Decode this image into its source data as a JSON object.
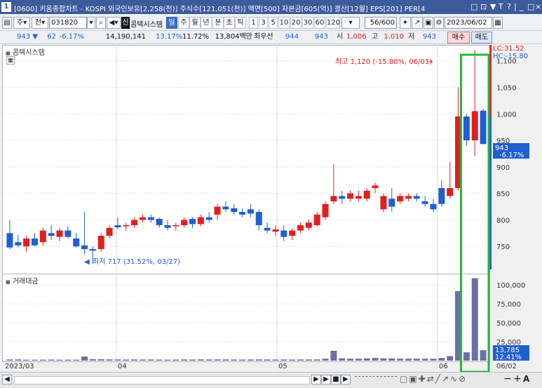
{
  "window": {
    "number": "1",
    "title": "[0600] 키움종합차트 - KOSPI 외국인보유[2,258(천)] 주식수[121,051(천)] 액면[500] 자본금[605(억)] 결산[12월] EPS[201] PER[4",
    "controls": [
      "□",
      "⊡",
      "▼",
      "T",
      "?",
      "|",
      "_",
      "□",
      "×"
    ]
  },
  "toolbar": {
    "mode": "주",
    "prev_label": "전",
    "code": "031820",
    "badge": "신",
    "stock_name": "콤텍시스템",
    "period_tabs": [
      "일",
      "주",
      "월",
      "년",
      "분",
      "초",
      "틱"
    ],
    "active_tab": "일",
    "interval_buttons": [
      "1",
      "3",
      "5",
      "10",
      "20",
      "30",
      "60",
      "120"
    ],
    "count_value": "56",
    "count_total": "/600",
    "date": "2023/06/02"
  },
  "quote": {
    "price": "943",
    "arrow": "▼",
    "change": "62",
    "change_rate": "-6.17%",
    "volume": "14,190,141",
    "rate2": "13.17%",
    "rate3": "11.72%",
    "amount": "13,804백만",
    "best_label": "최우선",
    "best_sell": "944",
    "best_buy": "943",
    "open_label": "시",
    "open": "1,006",
    "high_label": "고",
    "high": "1,010",
    "low_label": "저",
    "low": "943",
    "buy_label": "매수",
    "sell_label": "매도"
  },
  "price_panel": {
    "label": "콤텍시스템",
    "lc_label": "LC:31.52",
    "hc_label": "HC:-15.80",
    "current_price": "943",
    "current_rate": "-6.17%",
    "high_annotation": "최고 1,120 (-15.80%, 06/01)",
    "low_annotation": "최저 717 (31.52%, 03/27)",
    "ticks": [
      "1,100",
      "1,050",
      "1,000",
      "950",
      "900",
      "850",
      "800",
      "750"
    ]
  },
  "volume_panel": {
    "label": "거래대금",
    "ticks": [
      "100,000",
      "75,000",
      "50,000",
      "25,000"
    ],
    "current_value": "13,785",
    "current_rate": "12.41%"
  },
  "xaxis": {
    "labels": [
      "2023/03",
      "04",
      "05",
      "06"
    ],
    "right_label": "06/02"
  },
  "colors": {
    "up": "#e02020",
    "down": "#1f5fd0",
    "volume": "#6b6fa8",
    "highlight": "#28b43c"
  },
  "chart_data": {
    "type": "candlestick",
    "ylim": [
      700,
      1130
    ],
    "volume_ylim": [
      0,
      115000
    ],
    "candles": [
      {
        "o": 775,
        "h": 800,
        "l": 745,
        "c": 748
      },
      {
        "o": 758,
        "h": 772,
        "l": 748,
        "c": 752
      },
      {
        "o": 750,
        "h": 770,
        "l": 740,
        "c": 765
      },
      {
        "o": 765,
        "h": 775,
        "l": 750,
        "c": 752
      },
      {
        "o": 758,
        "h": 785,
        "l": 752,
        "c": 780
      },
      {
        "o": 775,
        "h": 790,
        "l": 762,
        "c": 770
      },
      {
        "o": 768,
        "h": 785,
        "l": 760,
        "c": 780
      },
      {
        "o": 780,
        "h": 788,
        "l": 765,
        "c": 768
      },
      {
        "o": 765,
        "h": 775,
        "l": 748,
        "c": 750
      },
      {
        "o": 752,
        "h": 815,
        "l": 735,
        "c": 745
      },
      {
        "o": 745,
        "h": 750,
        "l": 717,
        "c": 742
      },
      {
        "o": 745,
        "h": 775,
        "l": 740,
        "c": 770
      },
      {
        "o": 770,
        "h": 790,
        "l": 765,
        "c": 785
      },
      {
        "o": 790,
        "h": 805,
        "l": 782,
        "c": 786
      },
      {
        "o": 788,
        "h": 795,
        "l": 780,
        "c": 790
      },
      {
        "o": 790,
        "h": 805,
        "l": 785,
        "c": 800
      },
      {
        "o": 800,
        "h": 810,
        "l": 795,
        "c": 805
      },
      {
        "o": 805,
        "h": 810,
        "l": 795,
        "c": 800
      },
      {
        "o": 802,
        "h": 805,
        "l": 785,
        "c": 790
      },
      {
        "o": 790,
        "h": 800,
        "l": 780,
        "c": 785
      },
      {
        "o": 788,
        "h": 795,
        "l": 780,
        "c": 790
      },
      {
        "o": 790,
        "h": 805,
        "l": 785,
        "c": 800
      },
      {
        "o": 802,
        "h": 805,
        "l": 785,
        "c": 792
      },
      {
        "o": 792,
        "h": 810,
        "l": 788,
        "c": 805
      },
      {
        "o": 805,
        "h": 815,
        "l": 795,
        "c": 800
      },
      {
        "o": 810,
        "h": 830,
        "l": 800,
        "c": 825
      },
      {
        "o": 825,
        "h": 835,
        "l": 815,
        "c": 820
      },
      {
        "o": 822,
        "h": 830,
        "l": 810,
        "c": 815
      },
      {
        "o": 815,
        "h": 822,
        "l": 805,
        "c": 810
      },
      {
        "o": 820,
        "h": 830,
        "l": 805,
        "c": 812
      },
      {
        "o": 815,
        "h": 820,
        "l": 780,
        "c": 790
      },
      {
        "o": 785,
        "h": 795,
        "l": 775,
        "c": 780
      },
      {
        "o": 778,
        "h": 790,
        "l": 770,
        "c": 782
      },
      {
        "o": 780,
        "h": 790,
        "l": 760,
        "c": 768
      },
      {
        "o": 770,
        "h": 785,
        "l": 762,
        "c": 780
      },
      {
        "o": 780,
        "h": 795,
        "l": 775,
        "c": 790
      },
      {
        "o": 785,
        "h": 800,
        "l": 780,
        "c": 795
      },
      {
        "o": 790,
        "h": 815,
        "l": 788,
        "c": 810
      },
      {
        "o": 805,
        "h": 835,
        "l": 800,
        "c": 830
      },
      {
        "o": 835,
        "h": 905,
        "l": 830,
        "c": 845
      },
      {
        "o": 845,
        "h": 855,
        "l": 830,
        "c": 840
      },
      {
        "o": 840,
        "h": 855,
        "l": 835,
        "c": 850
      },
      {
        "o": 840,
        "h": 855,
        "l": 835,
        "c": 845
      },
      {
        "o": 840,
        "h": 860,
        "l": 835,
        "c": 855
      },
      {
        "o": 860,
        "h": 870,
        "l": 850,
        "c": 865
      },
      {
        "o": 820,
        "h": 850,
        "l": 815,
        "c": 845
      },
      {
        "o": 840,
        "h": 860,
        "l": 815,
        "c": 825
      },
      {
        "o": 835,
        "h": 850,
        "l": 830,
        "c": 845
      },
      {
        "o": 840,
        "h": 850,
        "l": 835,
        "c": 845
      },
      {
        "o": 845,
        "h": 850,
        "l": 835,
        "c": 840
      },
      {
        "o": 835,
        "h": 845,
        "l": 825,
        "c": 830
      },
      {
        "o": 830,
        "h": 840,
        "l": 815,
        "c": 820
      },
      {
        "o": 860,
        "h": 875,
        "l": 825,
        "c": 830
      },
      {
        "o": 845,
        "h": 910,
        "l": 840,
        "c": 860
      },
      {
        "o": 860,
        "h": 1050,
        "l": 855,
        "c": 995
      },
      {
        "o": 995,
        "h": 1000,
        "l": 940,
        "c": 950
      },
      {
        "o": 950,
        "h": 1120,
        "l": 920,
        "c": 1005
      },
      {
        "o": 1006,
        "h": 1010,
        "l": 943,
        "c": 943
      }
    ],
    "volume": [
      1500,
      1500,
      1200,
      1200,
      1300,
      1400,
      1200,
      1300,
      1200,
      5500,
      1800,
      1800,
      1600,
      1500,
      1400,
      1500,
      1400,
      1500,
      1400,
      1300,
      1400,
      1500,
      1400,
      1600,
      1500,
      1600,
      1500,
      1400,
      1400,
      1500,
      1600,
      1500,
      1400,
      1500,
      1400,
      1500,
      1500,
      1600,
      2500,
      13000,
      3000,
      2500,
      2500,
      3000,
      3500,
      3000,
      3000,
      2500,
      2500,
      2500,
      2500,
      2500,
      3500,
      6000,
      92000,
      11000,
      109000,
      13785
    ]
  }
}
